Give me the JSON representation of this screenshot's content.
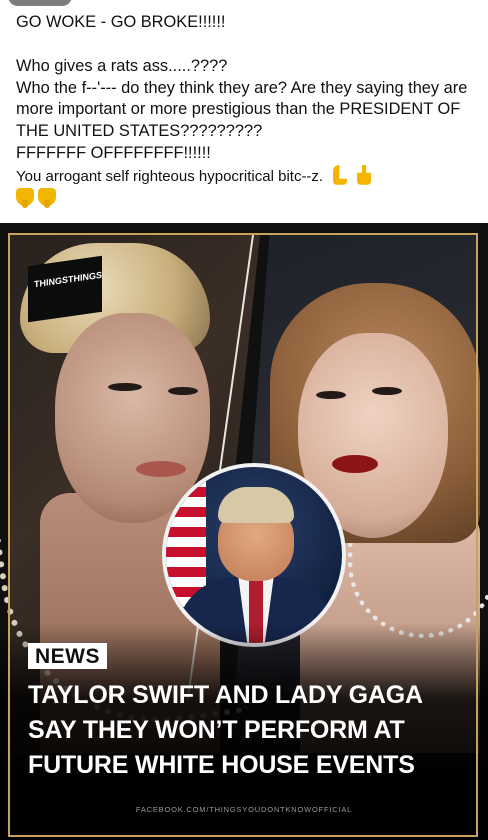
{
  "post": {
    "lines": [
      "GO WOKE - GO BROKE!!!!!!",
      "",
      "Who gives a rats ass.....????",
      "Who the f--'--- do they think they are? Are they saying they are more important or more prestigious than the PRESIDENT OF THE UNITED STATES?????????",
      "FFFFFFF OFFFFFFFF!!!!!!",
      "You arrogant self righteous hypocritical bitc--z."
    ],
    "emojis": [
      "hand-pointing-left-icon",
      "hand-pointing-up-icon",
      "thumbs-down-icon",
      "thumbs-down-icon"
    ]
  },
  "image": {
    "logo_text_left": "THINGS",
    "logo_text_right": "THINGS",
    "badge": "NEWS",
    "headline": [
      "TAYLOR SWIFT AND LADY GAGA",
      "SAY THEY WON’T PERFORM AT",
      "FUTURE WHITE HOUSE EVENTS"
    ],
    "footer": "FACEBOOK.COM/THINGSYOUDONTKNOWOFFICIAL"
  },
  "colors": {
    "headline_text": "#ffffff",
    "badge_bg": "#ffffff",
    "frame_gold": "#c9a25a"
  }
}
